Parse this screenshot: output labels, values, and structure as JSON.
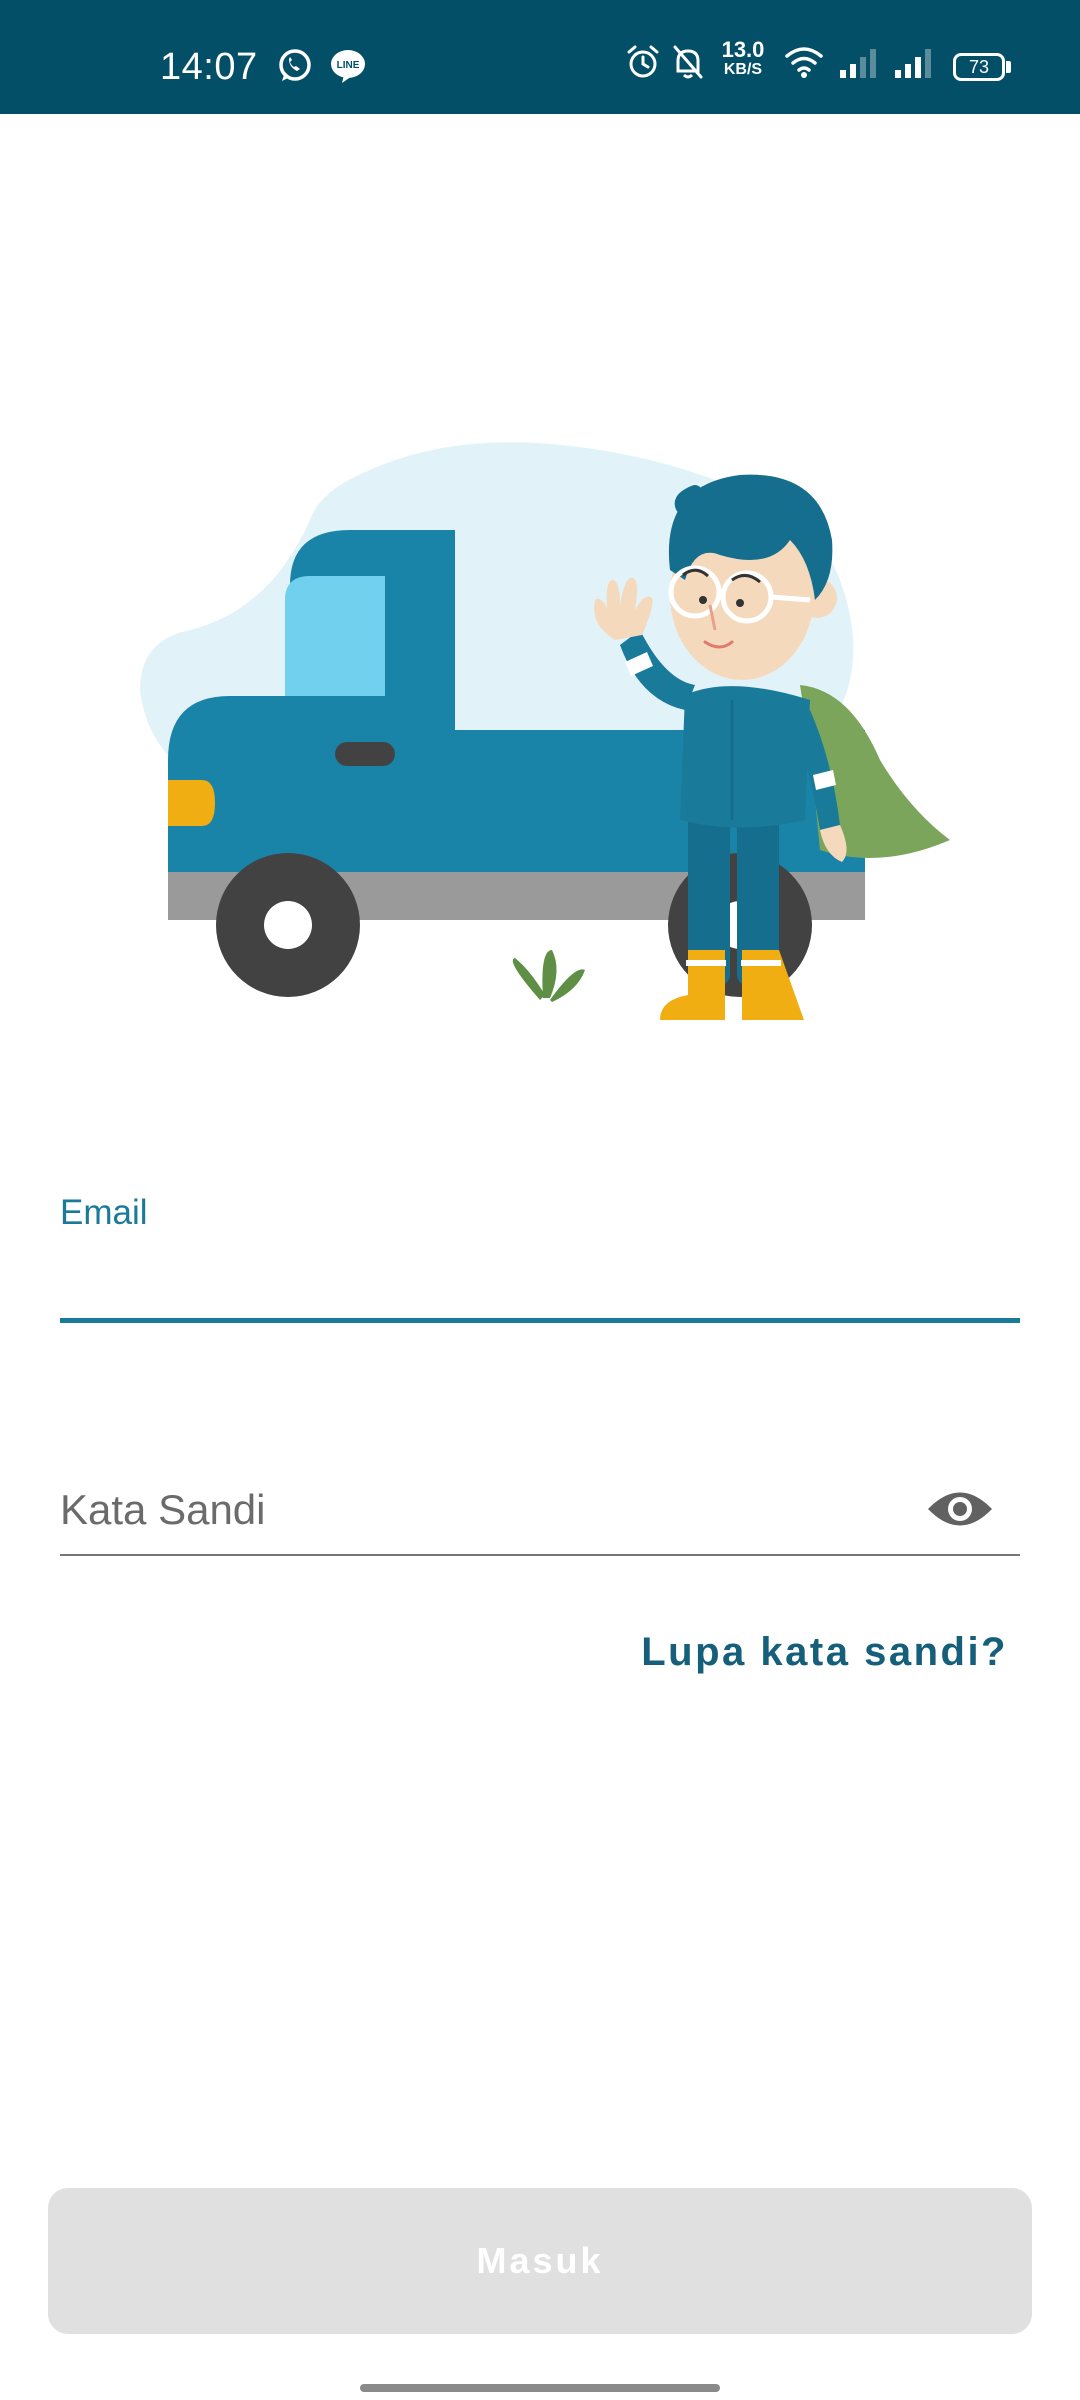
{
  "status_bar": {
    "time": "14:07",
    "net_speed_value": "13.0",
    "net_speed_unit": "KB/S",
    "battery": "73",
    "background_color": "#034f68",
    "icons": [
      "whatsapp-icon",
      "line-icon",
      "alarm-icon",
      "silent-bell-icon",
      "wifi-icon",
      "signal-icon-1",
      "signal-icon-2",
      "battery-icon"
    ]
  },
  "illustration": {
    "icon": "delivery-truck-with-courier-illustration"
  },
  "form": {
    "email_label": "Email",
    "email_value": "",
    "password_placeholder": "Kata Sandi",
    "password_value": "",
    "forgot_password_label": "Lupa kata sandi?",
    "login_button_label": "Masuk",
    "accent_color": "#1a7a9a"
  }
}
